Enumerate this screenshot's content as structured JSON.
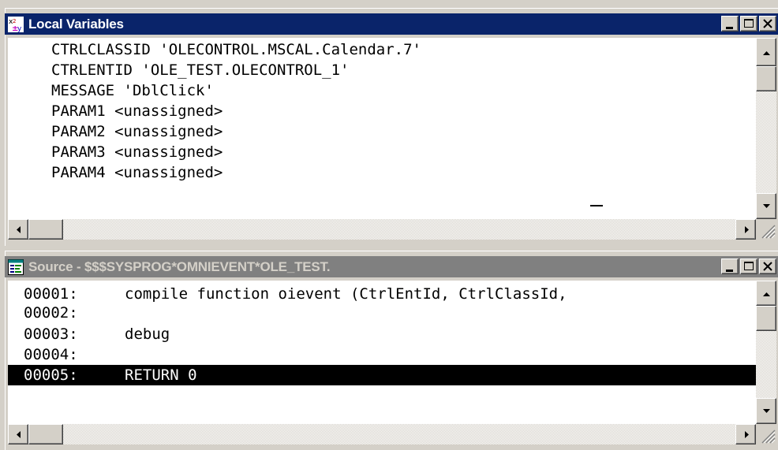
{
  "local_variables_window": {
    "title": "Local Variables",
    "icon": "variables-icon",
    "lines": [
      "CTRLCLASSID 'OLECONTROL.MSCAL.Calendar.7'",
      "CTRLENTID 'OLE_TEST.OLECONTROL_1'",
      "MESSAGE 'DblClick'",
      "PARAM1 <unassigned>",
      "PARAM2 <unassigned>",
      "PARAM3 <unassigned>",
      "PARAM4 <unassigned>"
    ]
  },
  "source_window": {
    "title": "Source - $$$SYSPROG*OMNIEVENT*OLE_TEST.",
    "icon": "source-code-icon",
    "rows": [
      {
        "num": "00001:",
        "code": "compile function oievent (CtrlEntId, CtrlClassId,"
      },
      {
        "num": "00002:",
        "code": ""
      },
      {
        "num": "00003:",
        "code": "debug"
      },
      {
        "num": "00004:",
        "code": ""
      },
      {
        "num": "00005:",
        "code": "RETURN 0"
      }
    ],
    "selected_row_index": 4
  },
  "window_buttons": [
    "minimize-icon",
    "maximize-icon",
    "close-icon"
  ],
  "colors": {
    "active_title": "#0a246a",
    "inactive_title": "#808080",
    "face": "#d4d0c8",
    "selection": "#000000"
  }
}
